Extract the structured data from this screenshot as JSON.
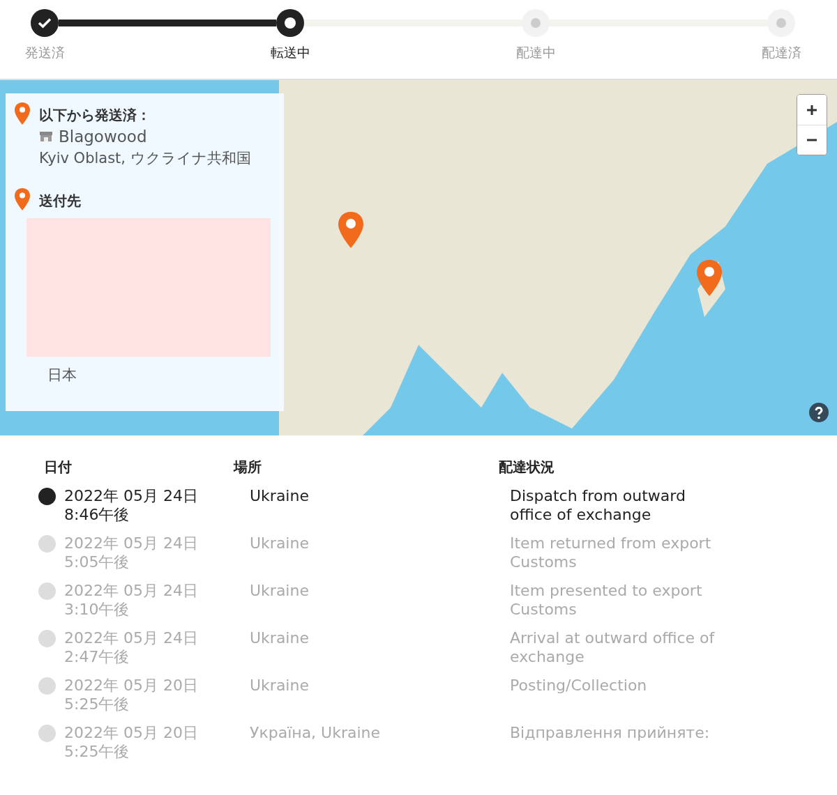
{
  "progress": {
    "steps": [
      {
        "label": "発送済",
        "completed": true,
        "selected": false
      },
      {
        "label": "転送中",
        "completed": false,
        "selected": true
      },
      {
        "label": "配達中",
        "completed": false,
        "selected": false
      },
      {
        "label": "配達済",
        "completed": false,
        "selected": false
      }
    ]
  },
  "map": {
    "origin_card": {
      "heading": "以下から発送済：",
      "store": "Blagowood",
      "region": "Kyiv Oblast, ウクライナ共和国"
    },
    "destination_card": {
      "heading": "送付先",
      "country": "日本"
    }
  },
  "history": {
    "columns": [
      "日付",
      "場所",
      "配達状況"
    ],
    "rows": [
      {
        "current": true,
        "date": "2022年 05月 24日",
        "time": "8:46午後",
        "place": "Ukraine",
        "status": "Dispatch from outward office of exchange"
      },
      {
        "current": false,
        "date": "2022年 05月 24日",
        "time": "5:05午後",
        "place": "Ukraine",
        "status": "Item returned from export Customs"
      },
      {
        "current": false,
        "date": "2022年 05月 24日",
        "time": "3:10午後",
        "place": "Ukraine",
        "status": "Item presented to export Customs"
      },
      {
        "current": false,
        "date": "2022年 05月 24日",
        "time": "2:47午後",
        "place": "Ukraine",
        "status": "Arrival at outward office of exchange"
      },
      {
        "current": false,
        "date": "2022年 05月 20日",
        "time": "5:25午後",
        "place": "Ukraine",
        "status": "Posting/Collection"
      },
      {
        "current": false,
        "date": "2022年 05月 20日",
        "time": "5:25午後",
        "place": "Україна, Ukraine",
        "status": "Відправлення прийняте:"
      }
    ]
  }
}
